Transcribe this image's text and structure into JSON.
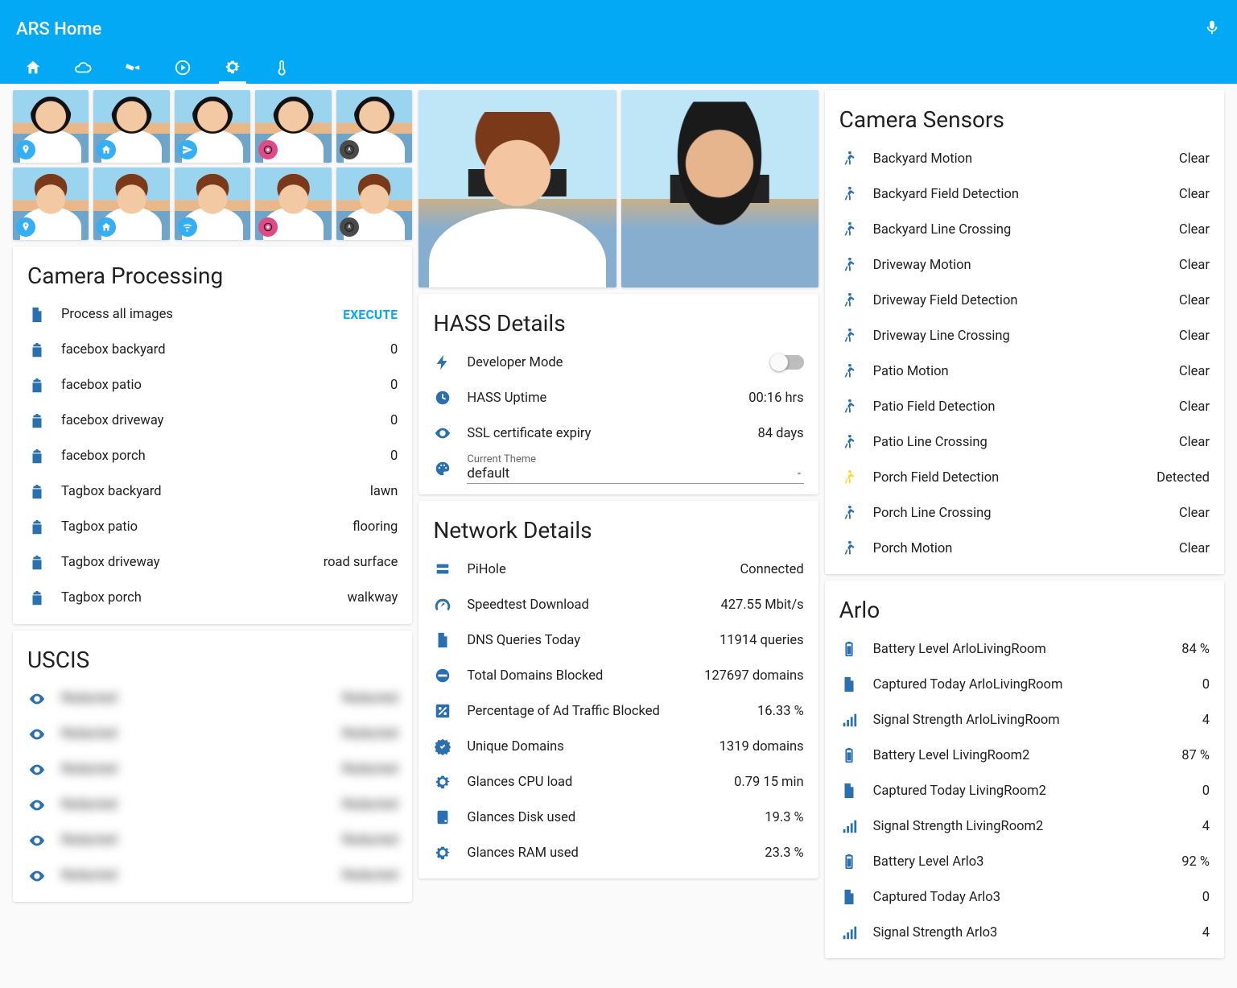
{
  "header": {
    "title": "ARS Home"
  },
  "tabs": [
    "home",
    "cloud",
    "camera",
    "play",
    "settings",
    "thermo"
  ],
  "active_tab_index": 4,
  "camera_processing": {
    "title": "Camera Processing",
    "execute_label": "EXECUTE",
    "rows": [
      {
        "icon": "doc",
        "label": "Process all images",
        "value": "",
        "action": "execute"
      },
      {
        "icon": "clip",
        "label": "facebox backyard",
        "value": "0"
      },
      {
        "icon": "clip",
        "label": "facebox patio",
        "value": "0"
      },
      {
        "icon": "clip",
        "label": "facebox driveway",
        "value": "0"
      },
      {
        "icon": "clip",
        "label": "facebox porch",
        "value": "0"
      },
      {
        "icon": "clip",
        "label": "Tagbox backyard",
        "value": "lawn"
      },
      {
        "icon": "clip",
        "label": "Tagbox patio",
        "value": "flooring"
      },
      {
        "icon": "clip",
        "label": "Tagbox driveway",
        "value": "road surface"
      },
      {
        "icon": "clip",
        "label": "Tagbox porch",
        "value": "walkway"
      }
    ]
  },
  "uscis": {
    "title": "USCIS",
    "rows": [
      {
        "label": "Redacted",
        "value": "Redacted"
      },
      {
        "label": "Redacted",
        "value": "Redacted"
      },
      {
        "label": "Redacted",
        "value": "Redacted"
      },
      {
        "label": "Redacted",
        "value": "Redacted"
      },
      {
        "label": "Redacted",
        "value": "Redacted"
      },
      {
        "label": "Redacted",
        "value": "Redacted"
      }
    ]
  },
  "hass": {
    "title": "HASS Details",
    "dev_mode_label": "Developer Mode",
    "dev_mode_on": false,
    "uptime_label": "HASS Uptime",
    "uptime_value": "00:16 hrs",
    "ssl_label": "SSL certificate expiry",
    "ssl_value": "84 days",
    "theme_caption": "Current Theme",
    "theme_value": "default"
  },
  "network": {
    "title": "Network Details",
    "rows": [
      {
        "icon": "server",
        "label": "PiHole",
        "value": "Connected"
      },
      {
        "icon": "speed",
        "label": "Speedtest Download",
        "value": "427.55 Mbit/s"
      },
      {
        "icon": "doc",
        "label": "DNS Queries Today",
        "value": "11914 queries"
      },
      {
        "icon": "block",
        "label": "Total Domains Blocked",
        "value": "127697 domains"
      },
      {
        "icon": "percent",
        "label": "Percentage of Ad Traffic Blocked",
        "value": "16.33 %"
      },
      {
        "icon": "verified",
        "label": "Unique Domains",
        "value": "1319 domains"
      },
      {
        "icon": "cog",
        "label": "Glances CPU load",
        "value": "0.79 15 min"
      },
      {
        "icon": "disk",
        "label": "Glances Disk used",
        "value": "19.3 %"
      },
      {
        "icon": "cog",
        "label": "Glances RAM used",
        "value": "23.3 %"
      }
    ]
  },
  "camera_sensors": {
    "title": "Camera Sensors",
    "rows": [
      {
        "label": "Backyard Motion",
        "value": "Clear",
        "state": "clear"
      },
      {
        "label": "Backyard Field Detection",
        "value": "Clear",
        "state": "clear"
      },
      {
        "label": "Backyard Line Crossing",
        "value": "Clear",
        "state": "clear"
      },
      {
        "label": "Driveway Motion",
        "value": "Clear",
        "state": "clear"
      },
      {
        "label": "Driveway Field Detection",
        "value": "Clear",
        "state": "clear"
      },
      {
        "label": "Driveway Line Crossing",
        "value": "Clear",
        "state": "clear"
      },
      {
        "label": "Patio Motion",
        "value": "Clear",
        "state": "clear"
      },
      {
        "label": "Patio Field Detection",
        "value": "Clear",
        "state": "clear"
      },
      {
        "label": "Patio Line Crossing",
        "value": "Clear",
        "state": "clear"
      },
      {
        "label": "Porch Field Detection",
        "value": "Detected",
        "state": "detected"
      },
      {
        "label": "Porch Line Crossing",
        "value": "Clear",
        "state": "clear"
      },
      {
        "label": "Porch Motion",
        "value": "Clear",
        "state": "clear"
      }
    ]
  },
  "arlo": {
    "title": "Arlo",
    "rows": [
      {
        "icon": "batt",
        "label": "Battery Level ArloLivingRoom",
        "value": "84 %"
      },
      {
        "icon": "file",
        "label": "Captured Today ArloLivingRoom",
        "value": "0"
      },
      {
        "icon": "signal",
        "label": "Signal Strength ArloLivingRoom",
        "value": "4"
      },
      {
        "icon": "batt",
        "label": "Battery Level LivingRoom2",
        "value": "87 %"
      },
      {
        "icon": "file",
        "label": "Captured Today LivingRoom2",
        "value": "0"
      },
      {
        "icon": "signal",
        "label": "Signal Strength LivingRoom2",
        "value": "4"
      },
      {
        "icon": "batt",
        "label": "Battery Level Arlo3",
        "value": "92 %"
      },
      {
        "icon": "file",
        "label": "Captured Today Arlo3",
        "value": "0"
      },
      {
        "icon": "signal",
        "label": "Signal Strength Arlo3",
        "value": "4"
      }
    ]
  },
  "person_thumbs": {
    "row1_badges": [
      "pin",
      "home",
      "send",
      "target",
      "compass"
    ],
    "row2_badges": [
      "pin",
      "home",
      "wifi",
      "target",
      "compass"
    ]
  }
}
